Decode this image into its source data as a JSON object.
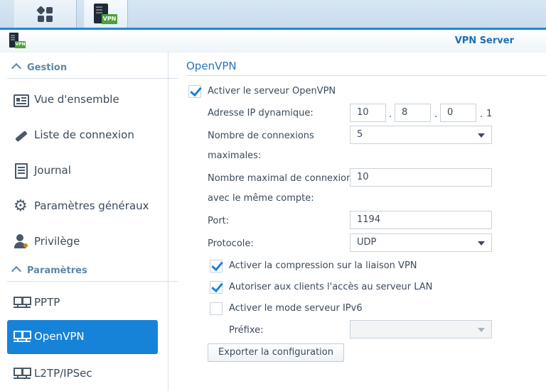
{
  "taskbar": {
    "main_menu_icon": "grid-icon",
    "open_app_icon": "vpn-server-icon",
    "open_app_badge": "VPN"
  },
  "app": {
    "title": "VPN Server",
    "icon_badge": "VPN"
  },
  "sidebar": {
    "sections": [
      {
        "label": "Gestion"
      },
      {
        "label": "Paramètres"
      }
    ],
    "items": [
      {
        "label": "Vue d'ensemble",
        "icon": "overview-icon"
      },
      {
        "label": "Liste de connexion",
        "icon": "plug-icon"
      },
      {
        "label": "Journal",
        "icon": "journal-icon"
      },
      {
        "label": "Paramètres généraux",
        "icon": "gear-icon"
      },
      {
        "label": "Privilège",
        "icon": "user-key-icon"
      },
      {
        "label": "PPTP",
        "icon": "network-icon"
      },
      {
        "label": "OpenVPN",
        "icon": "network-icon",
        "active": true
      },
      {
        "label": "L2TP/IPSec",
        "icon": "network-icon"
      }
    ]
  },
  "main": {
    "title": "OpenVPN",
    "enable_server": {
      "label": "Activer le serveur OpenVPN",
      "checked": true
    },
    "dynamic_ip": {
      "label": "Adresse IP dynamique:",
      "octets": [
        "10",
        "8",
        "0"
      ],
      "dot": ".",
      "last_octet": "1"
    },
    "max_connections": {
      "label_line1": "Nombre de connexions",
      "label_line2": "maximales:",
      "value": "5"
    },
    "max_same_account": {
      "label_line1": "Nombre maximal de connexions",
      "label_line2": "avec le même compte:",
      "value": "10"
    },
    "port": {
      "label": "Port:",
      "value": "1194"
    },
    "protocol": {
      "label": "Protocole:",
      "value": "UDP"
    },
    "compression": {
      "label": "Activer la compression sur la liaison VPN",
      "checked": true
    },
    "lan_access": {
      "label": "Autoriser aux clients l'accès au serveur LAN",
      "checked": true
    },
    "ipv6": {
      "label": "Activer le mode serveur IPv6",
      "checked": false
    },
    "prefix": {
      "label": "Préfixe:",
      "value": ""
    },
    "export_button": "Exporter la configuration"
  },
  "colors": {
    "accent": "#1783d8",
    "title_blue": "#1b6fb5",
    "section_text": "#5c87a8",
    "badge_green": "#4ca13a"
  }
}
